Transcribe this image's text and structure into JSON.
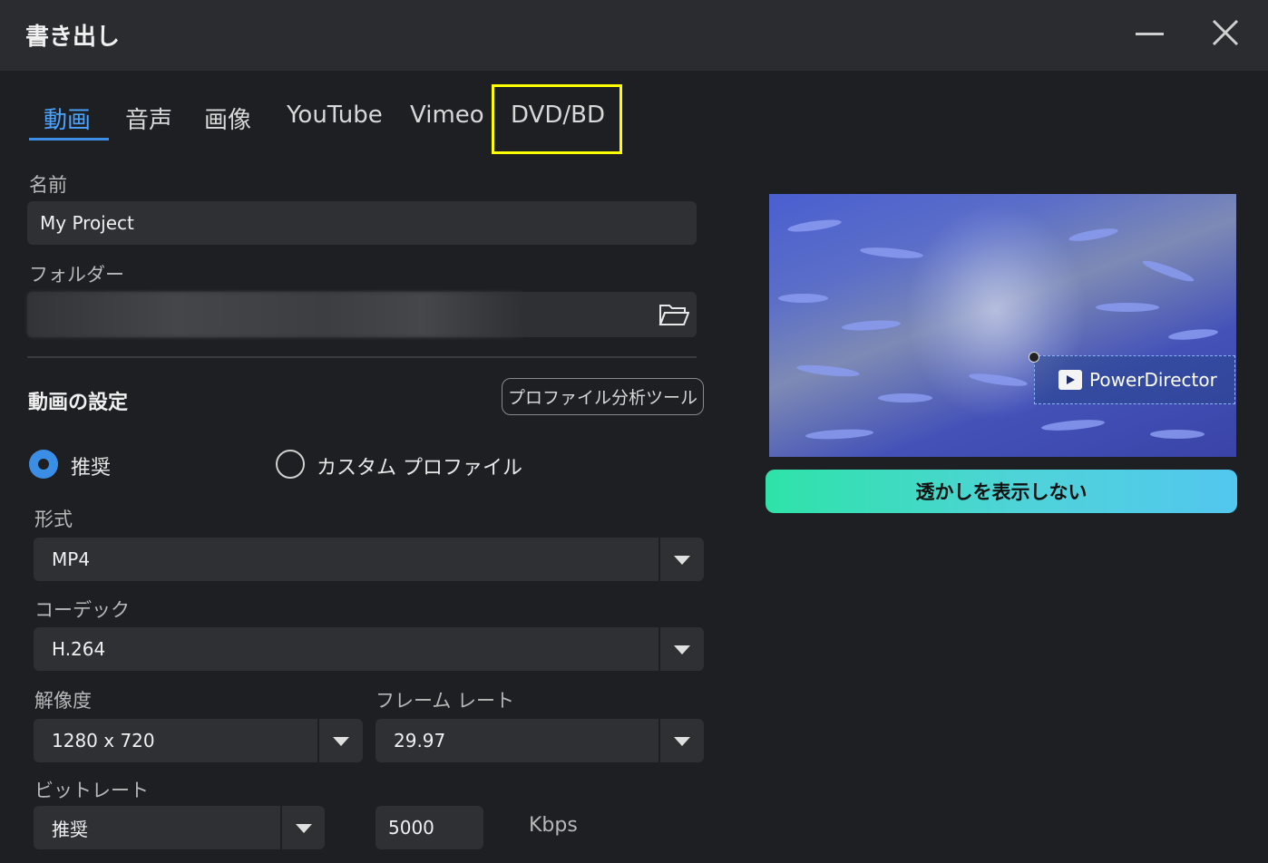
{
  "window": {
    "title": "書き出し"
  },
  "tabs": [
    "動画",
    "音声",
    "画像",
    "YouTube",
    "Vimeo",
    "DVD/BD"
  ],
  "name_field": {
    "label": "名前",
    "value": "My Project"
  },
  "folder_field": {
    "label": "フォルダー"
  },
  "video_settings": {
    "title": "動画の設定",
    "analyzer_button": "プロファイル分析ツール",
    "radio_recommended": "推奨",
    "radio_custom": "カスタム プロファイル",
    "selected": "推奨"
  },
  "format": {
    "label": "形式",
    "value": "MP4"
  },
  "codec": {
    "label": "コーデック",
    "value": "H.264"
  },
  "resolution": {
    "label": "解像度",
    "value": "1280 x 720"
  },
  "framerate": {
    "label": "フレーム レート",
    "value": "29.97"
  },
  "bitrate": {
    "label": "ビットレート",
    "mode": "推奨",
    "value": "5000",
    "unit": "Kbps"
  },
  "preview": {
    "watermark_text": "PowerDirector"
  },
  "remove_watermark_button": "透かしを表示しない",
  "colors": {
    "accent": "#3a8ee6",
    "highlight": "#ffff00"
  }
}
